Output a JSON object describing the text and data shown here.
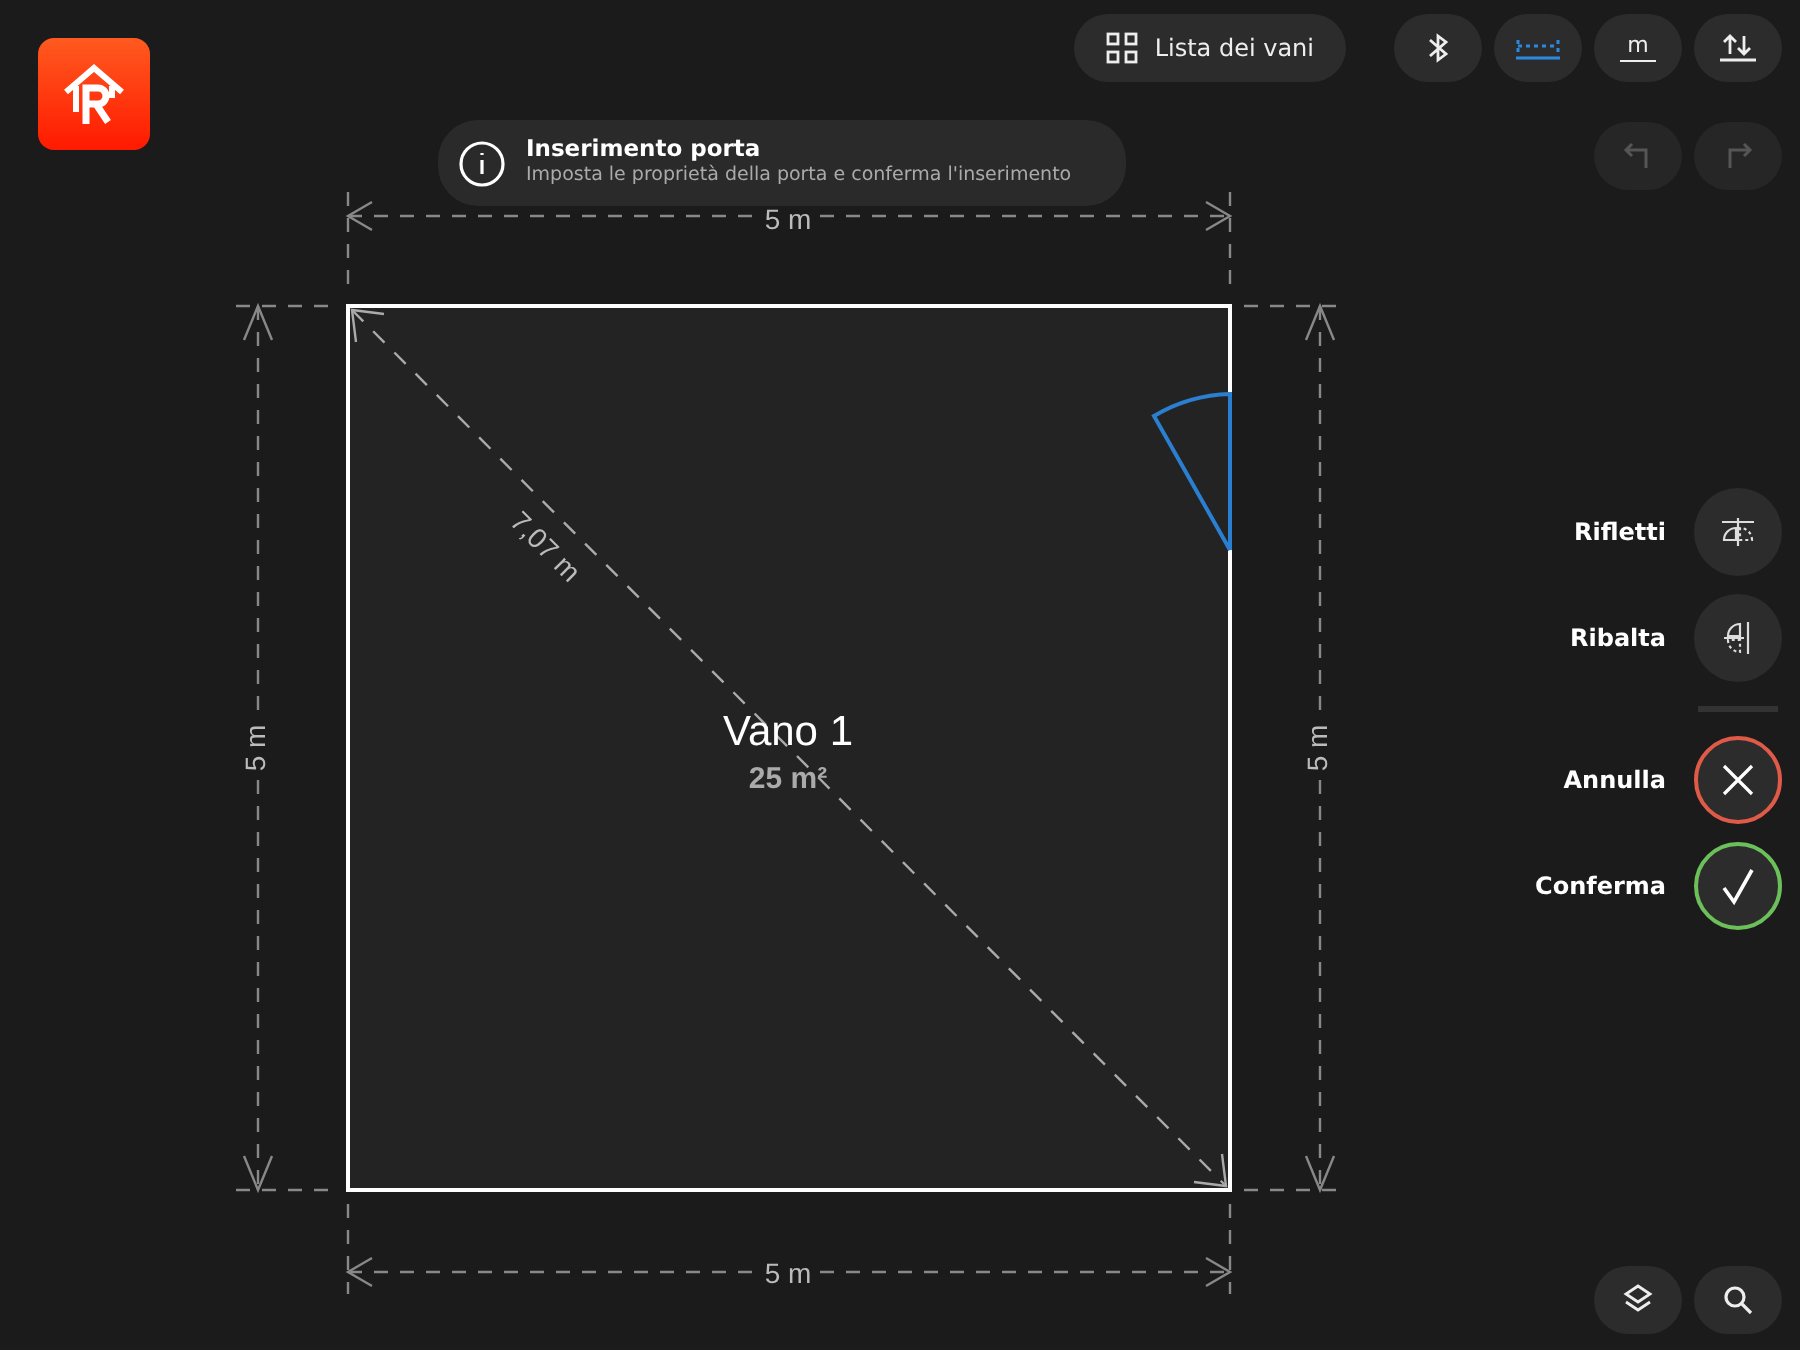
{
  "header": {
    "room_list_button": "Lista dei vani",
    "tools": [
      {
        "kind": "bluetooth",
        "selected": false
      },
      {
        "kind": "dimensions",
        "selected": true
      },
      {
        "kind": "units",
        "label": "m",
        "selected": false
      },
      {
        "kind": "sort",
        "selected": false
      }
    ]
  },
  "history": [
    {
      "kind": "undo",
      "disabled": true
    },
    {
      "kind": "redo",
      "disabled": true
    }
  ],
  "toast": {
    "title": "Inserimento porta",
    "message": "Imposta le proprietà della porta e conferma l'inserimento"
  },
  "plan": {
    "room": {
      "name": "Vano 1",
      "area": "25 m²"
    },
    "dimensions": {
      "top": "5 m",
      "left": "5 m",
      "right": "5 m",
      "bottom": "5 m",
      "diagonal": "7,07 m"
    }
  },
  "actions": [
    {
      "kind": "mirror",
      "label": "Rifletti"
    },
    {
      "kind": "flip",
      "label": "Ribalta"
    }
  ],
  "decisions": [
    {
      "kind": "cancel",
      "label": "Annulla"
    },
    {
      "kind": "confirm",
      "label": "Conferma"
    }
  ],
  "bottom_tools": [
    {
      "kind": "layers"
    },
    {
      "kind": "search"
    }
  ]
}
